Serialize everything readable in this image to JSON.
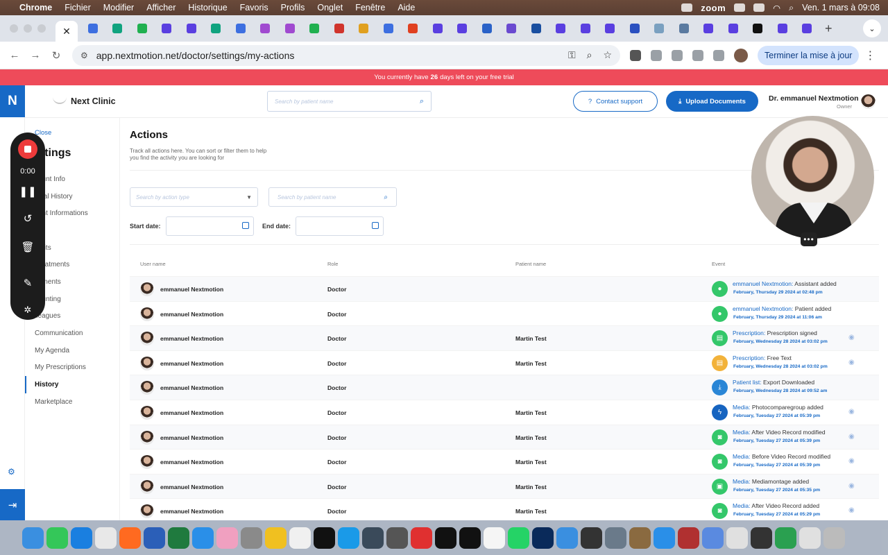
{
  "menubar": {
    "app": "Chrome",
    "items": [
      "Fichier",
      "Modifier",
      "Afficher",
      "Historique",
      "Favoris",
      "Profils",
      "Onglet",
      "Fenêtre",
      "Aide"
    ],
    "zoom_label": "zoom",
    "datetime": "Ven. 1 mars à 09:08"
  },
  "browser": {
    "url": "app.nextmotion.net/doctor/settings/my-actions",
    "finish_button": "Terminer la mise à jour"
  },
  "trial_banner": {
    "prefix": "You currently have",
    "days": "26",
    "suffix": "days left on your free trial"
  },
  "header": {
    "logo_letter": "N",
    "clinic_name": "Next Clinic",
    "search_placeholder": "Search by patient name",
    "contact_button": "Contact support",
    "upload_button": "Upload Documents",
    "doctor_name": "Dr. emmanuel Nextmotion",
    "doctor_role": "Owner"
  },
  "settings_sidebar": {
    "close_label": "Close",
    "title": "ettings",
    "items": [
      {
        "label": "count Info",
        "active": false
      },
      {
        "label": "dical History",
        "active": false
      },
      {
        "label": "tient Informations",
        "active": false
      },
      {
        "label": "gs",
        "active": false
      },
      {
        "label": "Visits",
        "active": false
      },
      {
        "label": "Treatments",
        "active": false
      },
      {
        "label": "cuments",
        "active": false
      },
      {
        "label": "counting",
        "active": false
      },
      {
        "label": "lleagues",
        "active": false
      },
      {
        "label": "Communication",
        "active": false
      },
      {
        "label": "My Agenda",
        "active": false
      },
      {
        "label": "My Prescriptions",
        "active": false
      },
      {
        "label": "History",
        "active": true
      },
      {
        "label": "Marketplace",
        "active": false
      }
    ]
  },
  "main": {
    "title": "Actions",
    "description": "Track all actions here. You can sort or filter them to help you find the activity you are looking for",
    "action_type_placeholder": "Search by action type",
    "patient_search_placeholder": "Search by patient name",
    "start_date_label": "Start date:",
    "end_date_label": "End date:",
    "columns": {
      "user": "User name",
      "role": "Role",
      "patient": "Patient name",
      "event": "Event"
    },
    "rows": [
      {
        "user": "emmanuel Nextmotion",
        "role": "Doctor",
        "patient": "",
        "event_key": "emmanuel Nextmotion:",
        "event_text": " Assistant added",
        "date": "February, Thursday 29 2024 at 02:48 pm",
        "icon_color": "#34c76a",
        "icon": "person-icon",
        "eye": false
      },
      {
        "user": "emmanuel Nextmotion",
        "role": "Doctor",
        "patient": "",
        "event_key": "emmanuel Nextmotion:",
        "event_text": " Patient added",
        "date": "February, Thursday 29 2024 at 11:06 am",
        "icon_color": "#34c76a",
        "icon": "person-icon",
        "eye": false
      },
      {
        "user": "emmanuel Nextmotion",
        "role": "Doctor",
        "patient": "Martin Test",
        "event_key": "Prescription:",
        "event_text": " Prescription signed",
        "date": "February, Wednesday 28 2024 at 03:02 pm",
        "icon_color": "#34c76a",
        "icon": "document-icon",
        "eye": true
      },
      {
        "user": "emmanuel Nextmotion",
        "role": "Doctor",
        "patient": "Martin Test",
        "event_key": "Prescription:",
        "event_text": " Free Text",
        "date": "February, Wednesday 28 2024 at 03:02 pm",
        "icon_color": "#f2b23a",
        "icon": "document-icon",
        "eye": true
      },
      {
        "user": "emmanuel Nextmotion",
        "role": "Doctor",
        "patient": "",
        "event_key": "Patient list:",
        "event_text": " Export Downloaded",
        "date": "February, Wednesday 28 2024 at 09:52 am",
        "icon_color": "#2a86d6",
        "icon": "download-icon",
        "eye": false
      },
      {
        "user": "emmanuel Nextmotion",
        "role": "Doctor",
        "patient": "Martin Test",
        "event_key": "Media:",
        "event_text": " Photocomparegroup added",
        "date": "February, Tuesday 27 2024 at 05:39 pm",
        "icon_color": "#1664c0",
        "icon": "lightning-icon",
        "eye": true
      },
      {
        "user": "emmanuel Nextmotion",
        "role": "Doctor",
        "patient": "Martin Test",
        "event_key": "Media:",
        "event_text": " After Video Record modified",
        "date": "February, Tuesday 27 2024 at 05:39 pm",
        "icon_color": "#34c76a",
        "icon": "camera-icon",
        "eye": true
      },
      {
        "user": "emmanuel Nextmotion",
        "role": "Doctor",
        "patient": "Martin Test",
        "event_key": "Media:",
        "event_text": " Before Video Record modified",
        "date": "February, Tuesday 27 2024 at 05:39 pm",
        "icon_color": "#34c76a",
        "icon": "camera-icon",
        "eye": true
      },
      {
        "user": "emmanuel Nextmotion",
        "role": "Doctor",
        "patient": "Martin Test",
        "event_key": "Media:",
        "event_text": " Mediamontage added",
        "date": "February, Tuesday 27 2024 at 05:35 pm",
        "icon_color": "#34c76a",
        "icon": "image-icon",
        "eye": true
      },
      {
        "user": "emmanuel Nextmotion",
        "role": "Doctor",
        "patient": "Martin Test",
        "event_key": "Media:",
        "event_text": " After Video Record added",
        "date": "February, Tuesday 27 2024 at 05:29 pm",
        "icon_color": "#34c76a",
        "icon": "camera-icon",
        "eye": true
      }
    ]
  },
  "recorder": {
    "time": "0:00"
  },
  "colors": {
    "brand": "#1769c6",
    "banner": "#ee4b5a"
  }
}
